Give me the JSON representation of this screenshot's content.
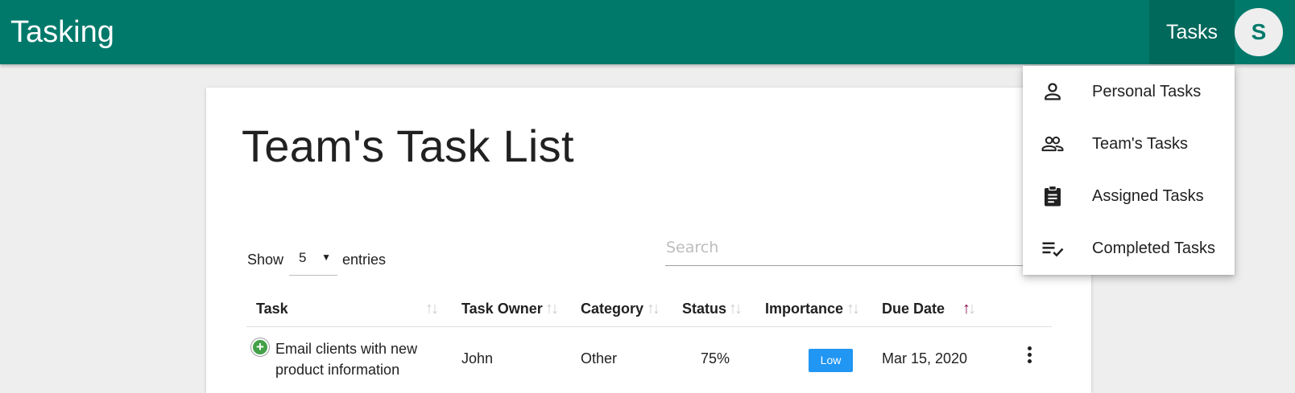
{
  "app": {
    "title": "Tasking"
  },
  "header": {
    "tasks_label": "Tasks",
    "avatar_initial": "S"
  },
  "colors": {
    "primary": "#00796b",
    "primary_dark": "#00695c",
    "badge_low": "#2196f3",
    "expand_green": "#43a047",
    "sort_active": "#880e4f"
  },
  "menu": {
    "items": [
      {
        "label": "Personal Tasks",
        "icon": "person-icon"
      },
      {
        "label": "Team's Tasks",
        "icon": "people-icon"
      },
      {
        "label": "Assigned Tasks",
        "icon": "clipboard-icon"
      },
      {
        "label": "Completed Tasks",
        "icon": "checklist-icon"
      }
    ]
  },
  "page": {
    "title": "Team's Task List"
  },
  "controls": {
    "show_label": "Show",
    "entries_value": "5",
    "entries_label": "entries",
    "search_placeholder": "Search"
  },
  "table": {
    "columns": [
      "Task",
      "Task Owner",
      "Category",
      "Status",
      "Importance",
      "Due Date"
    ],
    "sorted_column": "Due Date",
    "rows": [
      {
        "task_line1": "Email clients with new",
        "task_line2": "product information",
        "owner": "John",
        "category": "Other",
        "status": "75%",
        "importance": "Low",
        "due_date": "Mar 15, 2020"
      }
    ]
  }
}
